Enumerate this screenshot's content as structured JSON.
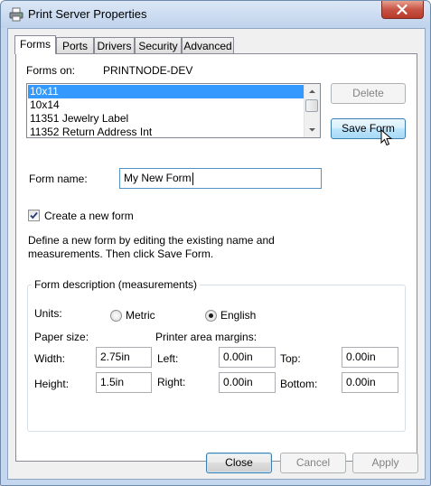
{
  "window": {
    "title": "Print Server Properties"
  },
  "tabs": [
    {
      "label": "Forms",
      "active": true
    },
    {
      "label": "Ports",
      "active": false
    },
    {
      "label": "Drivers",
      "active": false
    },
    {
      "label": "Security",
      "active": false
    },
    {
      "label": "Advanced",
      "active": false
    }
  ],
  "forms": {
    "forms_on_label": "Forms on:",
    "server_name": "PRINTNODE-DEV",
    "list_items": [
      "10x11",
      "10x14",
      "11351 Jewelry Label",
      "11352 Return Address Int"
    ],
    "selected_item": "10x11",
    "delete_label": "Delete",
    "save_form_label": "Save Form",
    "form_name_label": "Form name:",
    "form_name_value": "My New Form",
    "create_new_form_label": "Create a new form",
    "create_new_form_checked": true,
    "description_line1": "Define a new form by editing the existing name and",
    "description_line2": "measurements. Then click Save Form."
  },
  "measurements": {
    "legend": "Form description (measurements)",
    "units_label": "Units:",
    "metric_label": "Metric",
    "english_label": "English",
    "selected_unit": "English",
    "paper_size_label": "Paper size:",
    "printer_margins_label": "Printer area margins:",
    "width_label": "Width:",
    "width_value": "2.75in",
    "height_label": "Height:",
    "height_value": "1.5in",
    "left_label": "Left:",
    "left_value": "0.00in",
    "right_label": "Right:",
    "right_value": "0.00in",
    "top_label": "Top:",
    "top_value": "0.00in",
    "bottom_label": "Bottom:",
    "bottom_value": "0.00in"
  },
  "footer": {
    "close_label": "Close",
    "cancel_label": "Cancel",
    "apply_label": "Apply"
  },
  "icons": {
    "title_icon": "printer-icon",
    "close_icon": "close-icon",
    "cursor": "mouse-pointer-icon"
  },
  "colors": {
    "selection": "#3399ff",
    "title_close": "#c75444",
    "focus_border": "#3c7fb1"
  }
}
